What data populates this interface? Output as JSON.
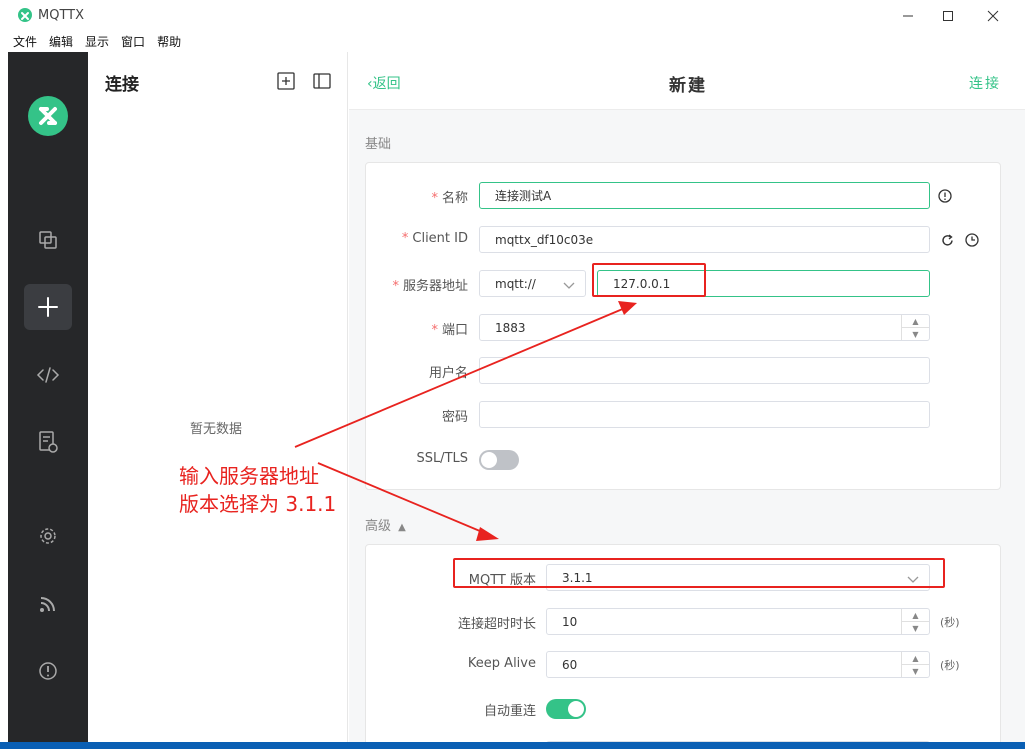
{
  "window": {
    "title": "MQTTX",
    "controls": {
      "minimize": "—",
      "maximize": "☐",
      "close": "✕"
    }
  },
  "menu": [
    "文件",
    "编辑",
    "显示",
    "窗口",
    "帮助"
  ],
  "sidebar": {
    "items": [
      {
        "name": "connections-icon"
      },
      {
        "name": "new-connection-icon",
        "active": true
      },
      {
        "name": "script-icon"
      },
      {
        "name": "log-icon"
      },
      {
        "name": "settings-icon"
      },
      {
        "name": "feed-icon"
      },
      {
        "name": "about-icon"
      }
    ]
  },
  "list_panel": {
    "title": "连接",
    "empty_text": "暂无数据"
  },
  "header": {
    "back": "返回",
    "title": "新建",
    "connect": "连接"
  },
  "basic": {
    "section_title": "基础",
    "name_label": "名称",
    "name_value": "连接测试A",
    "client_id_label": "Client ID",
    "client_id_value": "mqttx_df10c03e",
    "host_label": "服务器地址",
    "protocol_value": "mqtt://",
    "host_value": "127.0.0.1",
    "port_label": "端口",
    "port_value": "1883",
    "username_label": "用户名",
    "username_value": "",
    "password_label": "密码",
    "password_value": "",
    "ssl_label": "SSL/TLS",
    "ssl_on": false
  },
  "advanced": {
    "section_title": "高级",
    "mqtt_version_label": "MQTT 版本",
    "mqtt_version_value": "3.1.1",
    "connect_timeout_label": "连接超时时长",
    "connect_timeout_value": "10",
    "connect_timeout_unit": "(秒)",
    "keep_alive_label": "Keep Alive",
    "keep_alive_value": "60",
    "keep_alive_unit": "(秒)",
    "auto_reconnect_label": "自动重连",
    "auto_reconnect_on": true
  },
  "annotation": {
    "line1": "输入服务器地址",
    "line2": "版本选择为 3.1.1"
  },
  "colors": {
    "accent": "#34c388",
    "annotation": "#e8231f",
    "sidebar_bg": "#262729"
  }
}
